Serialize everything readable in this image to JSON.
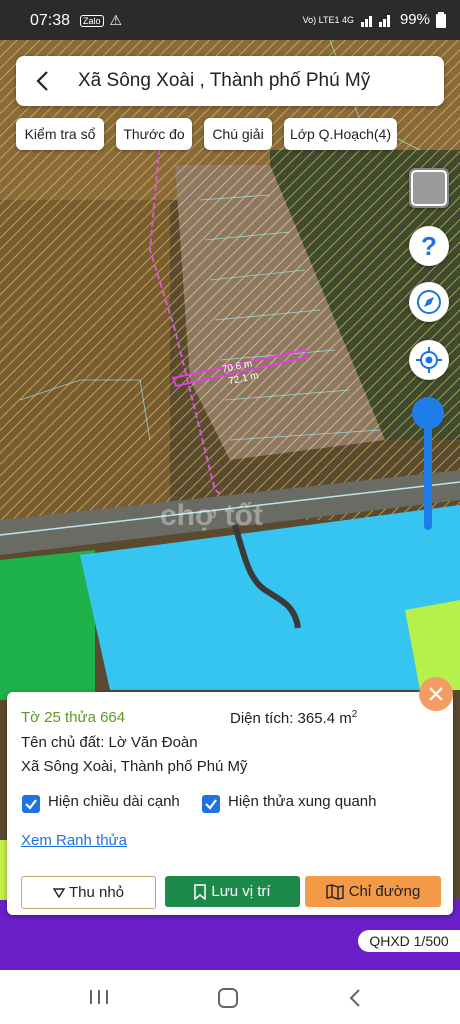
{
  "status_bar": {
    "time": "07:38",
    "app_badges": [
      "Zalo",
      "⚠"
    ],
    "network": "Vo) LTE1 4G",
    "battery": "99%"
  },
  "header": {
    "title": "Xã Sông Xoài , Thành phố Phú Mỹ"
  },
  "toolbar": {
    "chips": [
      "Kiểm tra sổ",
      "Thước đo",
      "Chú giải",
      "Lớp Q.Hoạch(4)"
    ]
  },
  "map": {
    "measure_label_1": "70.6 m",
    "measure_label_2": "72.1 m",
    "watermark": "chợ tốt",
    "scale_label": "QHXD 1/500",
    "colors": {
      "water": "#35c5f0",
      "agri": "#c9a066",
      "green": "#1fb24a",
      "purple": "#6a1fc9",
      "parcel": "#f0a0e0"
    }
  },
  "side_controls": [
    "layers-icon",
    "help-icon",
    "compass-icon",
    "locate-icon"
  ],
  "info_panel": {
    "parcel_id": "Tờ 25 thửa 664",
    "area_label": "Diện tích: 365.4 m",
    "area_unit_sup": "2",
    "owner": "Tên chủ đất: Lờ Văn Đoàn",
    "address": "Xã Sông Xoài, Thành phố Phú Mỹ",
    "checkbox_1": "Hiện chiều dài cạnh",
    "checkbox_2": "Hiện thửa xung quanh",
    "link": "Xem Ranh thửa",
    "btn_collapse": "Thu nhỏ",
    "btn_save": "Lưu vị trí",
    "btn_directions": "Chỉ đường"
  }
}
